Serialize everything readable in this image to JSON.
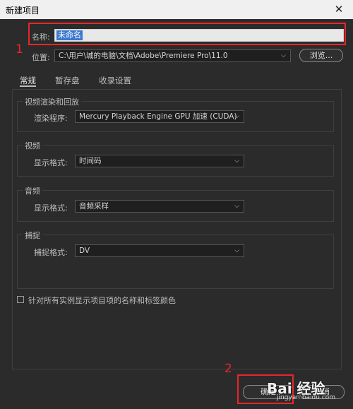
{
  "window": {
    "title": "新建项目",
    "close_glyph": "✕"
  },
  "name_field": {
    "label": "名称:",
    "value": "未命名"
  },
  "location": {
    "label": "位置:",
    "value": "C:\\用户\\城的电脑\\文档\\Adobe\\Premiere Pro\\11.0",
    "browse_label": "浏览..."
  },
  "tabs": [
    {
      "label": "常规"
    },
    {
      "label": "暂存盘"
    },
    {
      "label": "收录设置"
    }
  ],
  "groups": {
    "video_render": {
      "title": "视频渲染和回放",
      "field_label": "渲染程序:",
      "value": "Mercury Playback Engine GPU 加速 (CUDA)"
    },
    "video": {
      "title": "视频",
      "field_label": "显示格式:",
      "value": "时间码"
    },
    "audio": {
      "title": "音频",
      "field_label": "显示格式:",
      "value": "音频采样"
    },
    "capture": {
      "title": "捕捉",
      "field_label": "捕捉格式:",
      "value": "DV"
    }
  },
  "checkbox": {
    "label": "针对所有实例显示项目项的名称和标签颜色",
    "checked": false
  },
  "buttons": {
    "ok_label": "确定",
    "cancel_label": "取消"
  },
  "annotations": {
    "marker_1": "1",
    "marker_2": "2",
    "color": "#e8262a"
  },
  "watermark": {
    "text": "Bai 经验",
    "sub": "jingyan.baidu.com"
  }
}
